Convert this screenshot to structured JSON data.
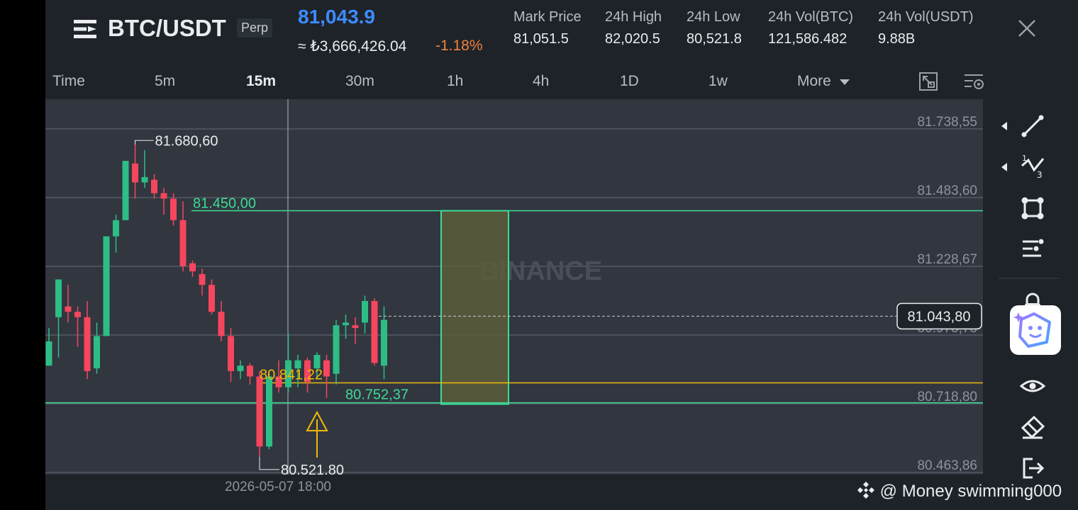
{
  "header": {
    "symbol": "BTC/USDT",
    "badge": "Perp",
    "last_price": "81,043.9",
    "price_try": "≈ ₺3,666,426.04",
    "change": "-1.18%",
    "stats": [
      {
        "label": "Mark Price",
        "value": "81,051.5"
      },
      {
        "label": "24h High",
        "value": "82,020.5"
      },
      {
        "label": "24h Low",
        "value": "80,521.8"
      },
      {
        "label": "24h Vol(BTC)",
        "value": "121,586.482"
      },
      {
        "label": "24h Vol(USDT)",
        "value": "9.88B"
      }
    ]
  },
  "timeframes": [
    "Time",
    "5m",
    "15m",
    "30m",
    "1h",
    "4h",
    "1D",
    "1w",
    "More"
  ],
  "active_timeframe": "15m",
  "chart": {
    "watermark": "BINANCE",
    "price_scale": [
      "81.738,55",
      "81.483,60",
      "81.228,67",
      "80.973,73",
      "80.718,80",
      "80.463,86"
    ],
    "current_price_label": "81.043,80",
    "high_label": "81.680,60",
    "low_label": "80.521,80",
    "line_label_green": "81.450,00",
    "line_label_yellow": "80.841,22",
    "line_label_green_low": "80.752,37",
    "crosshair_time": "2026-05-07 18:00",
    "colors": {
      "up": "#2ebd85",
      "down": "#f6465d",
      "yellow": "#f0b90b",
      "line_green": "#3ddc97"
    }
  },
  "candles": [
    {
      "o": 80.86,
      "h": 81.0,
      "l": 80.86,
      "c": 80.95
    },
    {
      "o": 81.04,
      "h": 81.16,
      "l": 80.89,
      "c": 81.18
    },
    {
      "o": 81.08,
      "h": 81.16,
      "l": 81.02,
      "c": 81.06
    },
    {
      "o": 81.06,
      "h": 81.08,
      "l": 80.93,
      "c": 81.04
    },
    {
      "o": 81.04,
      "h": 81.1,
      "l": 80.81,
      "c": 80.84
    },
    {
      "o": 80.85,
      "h": 81.02,
      "l": 80.83,
      "c": 80.97
    },
    {
      "o": 80.97,
      "h": 81.34,
      "l": 80.97,
      "c": 81.34
    },
    {
      "o": 81.34,
      "h": 81.42,
      "l": 81.28,
      "c": 81.4
    },
    {
      "o": 81.4,
      "h": 81.62,
      "l": 81.4,
      "c": 81.62
    },
    {
      "o": 81.61,
      "h": 81.68,
      "l": 81.48,
      "c": 81.54
    },
    {
      "o": 81.54,
      "h": 81.66,
      "l": 81.52,
      "c": 81.56
    },
    {
      "o": 81.55,
      "h": 81.57,
      "l": 81.48,
      "c": 81.5
    },
    {
      "o": 81.5,
      "h": 81.52,
      "l": 81.42,
      "c": 81.48
    },
    {
      "o": 81.48,
      "h": 81.5,
      "l": 81.38,
      "c": 81.4
    },
    {
      "o": 81.4,
      "h": 81.47,
      "l": 81.21,
      "c": 81.23
    },
    {
      "o": 81.24,
      "h": 81.25,
      "l": 81.19,
      "c": 81.21
    },
    {
      "o": 81.2,
      "h": 81.22,
      "l": 81.12,
      "c": 81.16
    },
    {
      "o": 81.16,
      "h": 81.18,
      "l": 81.05,
      "c": 81.06
    },
    {
      "o": 81.06,
      "h": 81.1,
      "l": 80.95,
      "c": 80.97
    },
    {
      "o": 80.97,
      "h": 81.0,
      "l": 80.8,
      "c": 80.84
    },
    {
      "o": 80.84,
      "h": 80.88,
      "l": 80.81,
      "c": 80.86
    },
    {
      "o": 80.86,
      "h": 80.87,
      "l": 80.79,
      "c": 80.82
    },
    {
      "o": 80.82,
      "h": 80.84,
      "l": 80.522,
      "c": 80.56
    },
    {
      "o": 80.56,
      "h": 80.83,
      "l": 80.55,
      "c": 80.82
    },
    {
      "o": 80.82,
      "h": 80.88,
      "l": 80.76,
      "c": 80.78
    },
    {
      "o": 80.78,
      "h": 80.98,
      "l": 80.76,
      "c": 80.88
    },
    {
      "o": 80.85,
      "h": 80.9,
      "l": 80.78,
      "c": 80.88
    },
    {
      "o": 80.88,
      "h": 80.89,
      "l": 80.76,
      "c": 80.8
    },
    {
      "o": 80.85,
      "h": 80.91,
      "l": 80.81,
      "c": 80.9
    },
    {
      "o": 80.88,
      "h": 80.9,
      "l": 80.74,
      "c": 80.82
    },
    {
      "o": 80.83,
      "h": 81.03,
      "l": 80.79,
      "c": 81.01
    },
    {
      "o": 81.01,
      "h": 81.05,
      "l": 80.96,
      "c": 81.02
    },
    {
      "o": 81.01,
      "h": 81.04,
      "l": 80.94,
      "c": 81.0
    },
    {
      "o": 81.02,
      "h": 81.12,
      "l": 80.98,
      "c": 81.1
    },
    {
      "o": 81.1,
      "h": 81.11,
      "l": 80.86,
      "c": 80.87
    },
    {
      "o": 80.86,
      "h": 81.08,
      "l": 80.81,
      "c": 81.03
    }
  ],
  "toolbar": [
    "trend-line-icon",
    "fib-wave-icon",
    "shape-icon",
    "indicator-settings-icon",
    "lock-icon",
    "eye-icon",
    "eraser-icon",
    "exit-icon"
  ],
  "credit": "@ Money swimming000"
}
